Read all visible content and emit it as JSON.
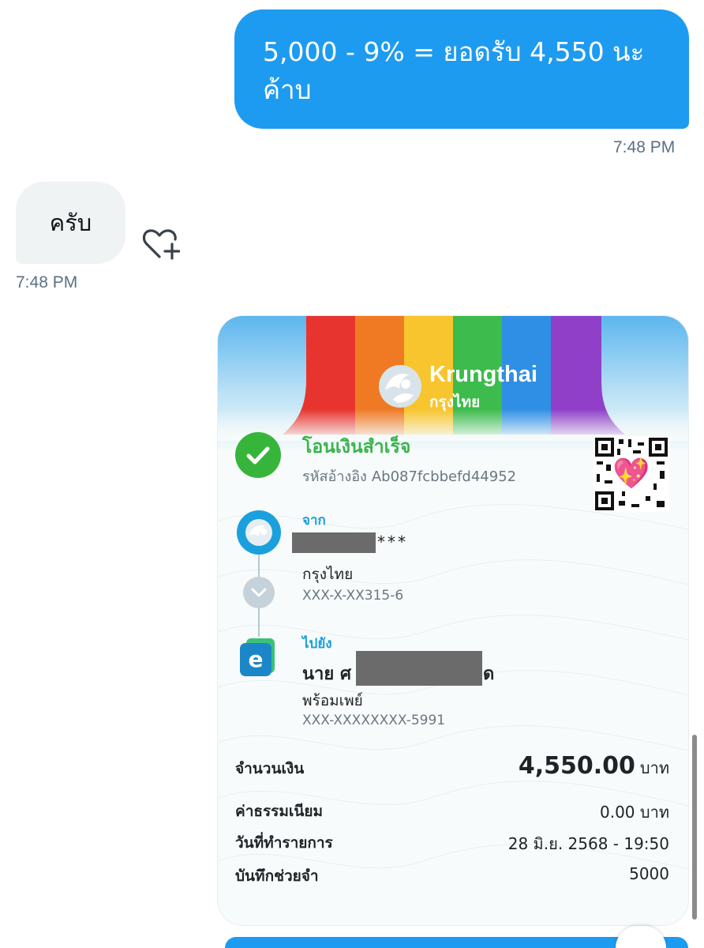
{
  "messages": {
    "outgoing": {
      "text": "5,000 - 9% = ยอดรับ 4,550 นะค้าบ",
      "time": "7:48 PM"
    },
    "incoming": {
      "text": "ครับ",
      "time": "7:48 PM",
      "react_icon": "heart-plus-icon"
    }
  },
  "slip": {
    "brand_en": "Krungthai",
    "brand_th": "กรุงไทย",
    "status_title": "โอนเงินสำเร็จ",
    "ref_label": "รหัสอ้างอิง",
    "ref_value": "Ab087fcbbefd44952",
    "from": {
      "label": "จาก",
      "masked_suffix": "***",
      "bank": "กรุงไทย",
      "account": "XXX-X-XX315-6"
    },
    "to": {
      "label": "ไปยัง",
      "name_prefix": "นาย ศ",
      "name_suffix": "ด",
      "bank": "พร้อมเพย์",
      "account": "XXX-XXXXXXXX-5991"
    },
    "amount": {
      "label": "จำนวนเงิน",
      "value": "4,550.00",
      "unit": "บาท"
    },
    "fee": {
      "label": "ค่าธรรมเนียม",
      "value": "0.00 บาท"
    },
    "date": {
      "label": "วันที่ทำรายการ",
      "value": "28 มิ.ย. 2568 - 19:50"
    },
    "memo": {
      "label": "บันทึกช่วยจำ",
      "value": "5000"
    }
  },
  "colors": {
    "bubble_blue": "#1d9bf0",
    "bubble_gray": "#eff3f4",
    "success_green": "#37b53b",
    "krungthai_blue": "#1aa0dc"
  }
}
